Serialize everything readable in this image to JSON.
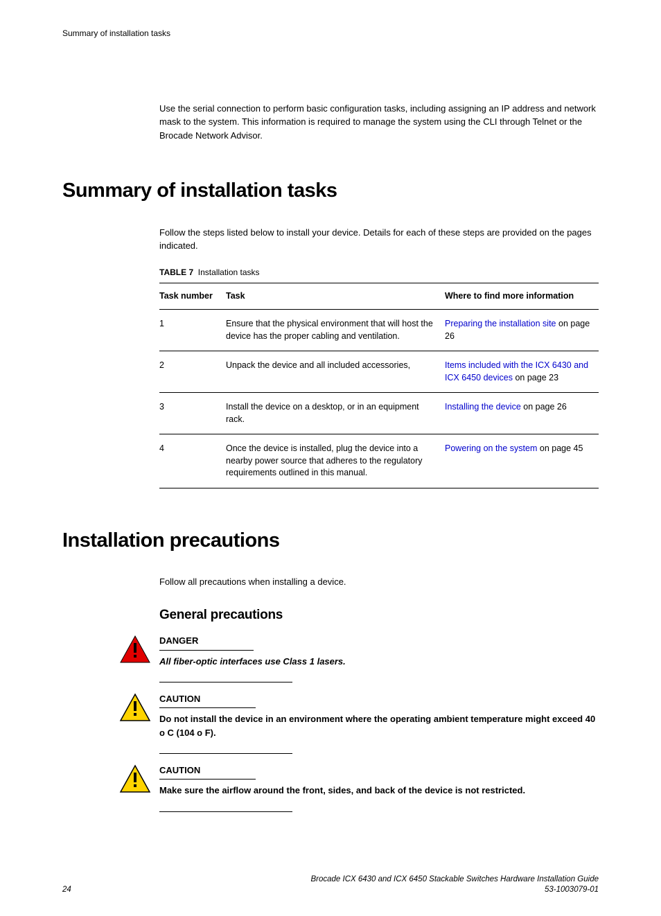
{
  "header": {
    "running_title": "Summary of installation tasks"
  },
  "intro": "Use the serial connection to perform basic configuration tasks, including assigning an IP address and network mask to the system. This information is required to manage the system using the CLI through Telnet or the Brocade Network Advisor.",
  "section1": {
    "title": "Summary of installation tasks",
    "body": "Follow the steps listed below to install your device. Details for each of these steps are provided on the pages indicated.",
    "table_label": "TABLE 7",
    "table_title": "Installation tasks",
    "headers": {
      "col1": "Task number",
      "col2": "Task",
      "col3": "Where to find more information"
    },
    "rows": [
      {
        "num": "1",
        "task": "Ensure that the physical environment that will host the device has the proper cabling and ventilation.",
        "link": "Preparing the installation site",
        "suffix": " on page 26"
      },
      {
        "num": "2",
        "task": "Unpack the device and all included accessories,",
        "link": "Items included with the ICX 6430 and ICX 6450 devices",
        "suffix": " on page 23"
      },
      {
        "num": "3",
        "task": "Install the device on a desktop, or in an equipment rack.",
        "link": "Installing the device",
        "suffix": " on page 26"
      },
      {
        "num": "4",
        "task": "Once the device is installed, plug the device into a nearby power source that adheres to the regulatory requirements outlined in this manual.",
        "link": "Powering on the system",
        "suffix": " on page 45"
      }
    ]
  },
  "section2": {
    "title": "Installation precautions",
    "body": "Follow all precautions when installing a device.",
    "subsection_title": "General precautions",
    "danger_label": "DANGER",
    "danger_text": "All fiber-optic interfaces use Class 1 lasers.",
    "caution1_label": "CAUTION",
    "caution1_text": "Do not install the device in an environment where the operating ambient temperature might exceed 40 o C (104 o F).",
    "caution2_label": "CAUTION",
    "caution2_text": "Make sure the airflow around the front, sides, and back of the device is not restricted."
  },
  "footer": {
    "page": "24",
    "title": "Brocade ICX 6430 and ICX 6450 Stackable Switches Hardware Installation Guide",
    "docnum": "53-1003079-01"
  }
}
